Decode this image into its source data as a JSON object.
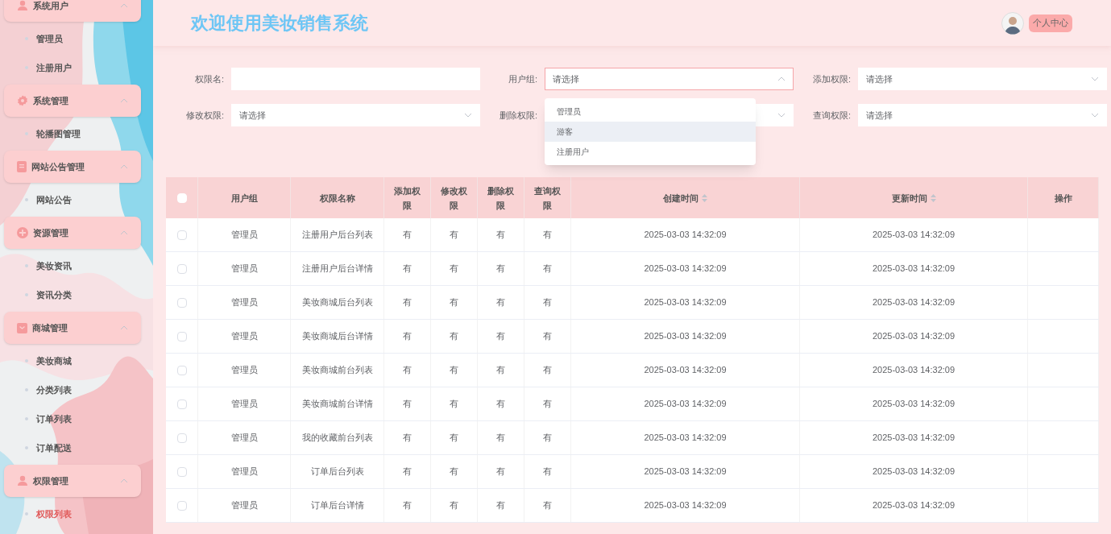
{
  "sidebar": {
    "groups": [
      {
        "title": "系统用户",
        "expanded": true,
        "items": [
          {
            "label": "管理员",
            "selected": false
          },
          {
            "label": "注册用户",
            "selected": false
          }
        ]
      },
      {
        "title": "系统管理",
        "expanded": true,
        "items": [
          {
            "label": "轮播图管理",
            "selected": false
          }
        ]
      },
      {
        "title": "网站公告管理",
        "expanded": true,
        "items": [
          {
            "label": "网站公告",
            "selected": false
          }
        ]
      },
      {
        "title": "资源管理",
        "expanded": true,
        "items": [
          {
            "label": "美妆资讯",
            "selected": false
          },
          {
            "label": "资讯分类",
            "selected": false
          }
        ]
      },
      {
        "title": "商城管理",
        "expanded": true,
        "items": [
          {
            "label": "美妆商城",
            "selected": false
          },
          {
            "label": "分类列表",
            "selected": false
          },
          {
            "label": "订单列表",
            "selected": false
          },
          {
            "label": "订单配送",
            "selected": false
          }
        ]
      },
      {
        "title": "权限管理",
        "expanded": true,
        "items": [
          {
            "label": "权限列表",
            "selected": true
          }
        ]
      }
    ]
  },
  "header": {
    "title": "欢迎使用美妆销售系统",
    "profile_button": "个人中心"
  },
  "filters": [
    {
      "kind": "text",
      "label": "权限名:"
    },
    {
      "kind": "select",
      "label": "用户组:",
      "placeholder": "请选择",
      "expanded": true,
      "options": [
        {
          "label": "管理员",
          "hovered": false
        },
        {
          "label": "游客",
          "hovered": true
        },
        {
          "label": "注册用户",
          "hovered": false
        }
      ]
    },
    {
      "kind": "select",
      "label": "添加权限:",
      "placeholder": "请选择",
      "expanded": false
    },
    {
      "kind": "select",
      "label": "修改权限:",
      "placeholder": "请选择",
      "expanded": false
    },
    {
      "kind": "select",
      "label": "删除权限:",
      "expanded": false
    },
    {
      "kind": "select",
      "label": "查询权限:",
      "placeholder": "请选择",
      "expanded": false
    }
  ],
  "table": {
    "columns": [
      {
        "label": "用户组",
        "sortable": false
      },
      {
        "label": "权限名称",
        "sortable": false
      },
      {
        "label": "添加权限",
        "sortable": false
      },
      {
        "label": "修改权限",
        "sortable": false
      },
      {
        "label": "删除权限",
        "sortable": false
      },
      {
        "label": "查询权限",
        "sortable": false
      },
      {
        "label": "创建时间",
        "sortable": true
      },
      {
        "label": "更新时间",
        "sortable": true
      },
      {
        "label": "操作",
        "sortable": false
      }
    ],
    "header_checked": false,
    "rows": [
      {
        "checked": false,
        "cells": [
          "管理员",
          "注册用户后台列表",
          "有",
          "有",
          "有",
          "有",
          "2025-03-03 14:32:09",
          "2025-03-03 14:32:09"
        ]
      },
      {
        "checked": false,
        "cells": [
          "管理员",
          "注册用户后台详情",
          "有",
          "有",
          "有",
          "有",
          "2025-03-03 14:32:09",
          "2025-03-03 14:32:09"
        ]
      },
      {
        "checked": false,
        "cells": [
          "管理员",
          "美妆商城后台列表",
          "有",
          "有",
          "有",
          "有",
          "2025-03-03 14:32:09",
          "2025-03-03 14:32:09"
        ]
      },
      {
        "checked": false,
        "cells": [
          "管理员",
          "美妆商城后台详情",
          "有",
          "有",
          "有",
          "有",
          "2025-03-03 14:32:09",
          "2025-03-03 14:32:09"
        ]
      },
      {
        "checked": false,
        "cells": [
          "管理员",
          "美妆商城前台列表",
          "有",
          "有",
          "有",
          "有",
          "2025-03-03 14:32:09",
          "2025-03-03 14:32:09"
        ]
      },
      {
        "checked": false,
        "cells": [
          "管理员",
          "美妆商城前台详情",
          "有",
          "有",
          "有",
          "有",
          "2025-03-03 14:32:09",
          "2025-03-03 14:32:09"
        ]
      },
      {
        "checked": false,
        "cells": [
          "管理员",
          "我的收藏前台列表",
          "有",
          "有",
          "有",
          "有",
          "2025-03-03 14:32:09",
          "2025-03-03 14:32:09"
        ]
      },
      {
        "checked": false,
        "cells": [
          "管理员",
          "订单后台列表",
          "有",
          "有",
          "有",
          "有",
          "2025-03-03 14:32:09",
          "2025-03-03 14:32:09"
        ]
      },
      {
        "checked": false,
        "cells": [
          "管理员",
          "订单后台详情",
          "有",
          "有",
          "有",
          "有",
          "2025-03-03 14:32:09",
          "2025-03-03 14:32:09"
        ]
      }
    ]
  }
}
